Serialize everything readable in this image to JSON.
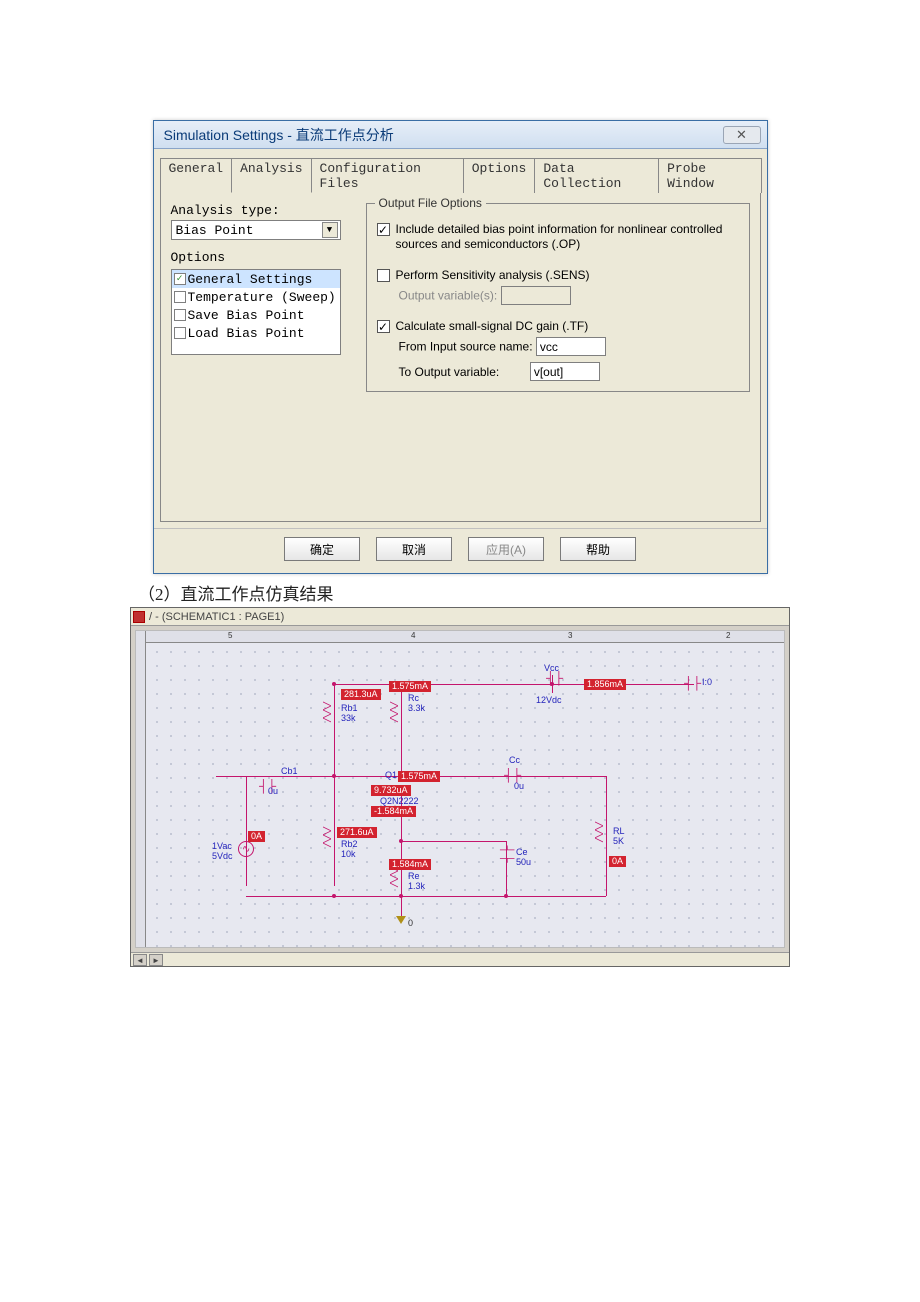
{
  "dialog": {
    "title": "Simulation Settings - 直流工作点分析",
    "tabs": [
      "General",
      "Analysis",
      "Configuration Files",
      "Options",
      "Data Collection",
      "Probe Window"
    ],
    "active_tab_index": 1,
    "analysis_type_label": "Analysis type:",
    "analysis_type_value": "Bias Point",
    "options_label": "Options",
    "option_items": [
      {
        "label": "General Settings",
        "checked": true,
        "selected": true
      },
      {
        "label": "Temperature (Sweep)",
        "checked": false,
        "selected": false
      },
      {
        "label": "Save Bias Point",
        "checked": false,
        "selected": false
      },
      {
        "label": "Load Bias Point",
        "checked": false,
        "selected": false
      }
    ],
    "groupbox_title": "Output File Options",
    "chk_op": {
      "checked": true,
      "label": "Include detailed bias point information for nonlinear controlled sources and semiconductors (.OP)"
    },
    "chk_sens": {
      "checked": false,
      "label": "Perform Sensitivity analysis (.SENS)"
    },
    "sens_var_label": "Output variable(s):",
    "sens_var_value": "",
    "chk_tf": {
      "checked": true,
      "label": "Calculate small-signal DC gain (.TF)"
    },
    "tf_from_label": "From Input source name:",
    "tf_from_value": "vcc",
    "tf_to_label": "To Output variable:",
    "tf_to_value": "v[out]",
    "buttons": {
      "ok": "确定",
      "cancel": "取消",
      "apply": "应用(A)",
      "help": "帮助"
    }
  },
  "document": {
    "line": "（2）直流工作点仿真结果"
  },
  "schematic": {
    "tab_bar": "/ - (SCHEMATIC1 : PAGE1)",
    "ruler_numbers": [
      "5",
      "4",
      "3",
      "2"
    ],
    "labels": {
      "vcc": "Vcc",
      "vcc_dc": "12Vdc",
      "i_probe": "I:0",
      "rb1": "Rb1",
      "rb1_val": "33k",
      "rc": "Rc",
      "rc_val": "3.3k",
      "cb1": "Cb1",
      "cb1_val": "0u",
      "q1": "Q1",
      "q1_model": "Q2N2222",
      "cc": "Cc",
      "cc_val": "0u",
      "rb2": "Rb2",
      "rb2_val": "10k",
      "ce": "Ce",
      "ce_val": "50u",
      "re": "Re",
      "re_val": "1.3k",
      "rl": "RL",
      "rl_val": "5K",
      "source1": "1Vac",
      "source2": "5Vdc",
      "gnd": "0"
    },
    "annotations": {
      "rb1_i": "281.3uA",
      "rc_i": "1.575mA",
      "vcc_i": "1.856mA",
      "q1_ic": "1.575mA",
      "q1_ib": "9.732uA",
      "q1_ie": "-1.584mA",
      "rb2_i": "271.6uA",
      "re_i": "1.584mA",
      "src_i": "0A",
      "rl_i": "0A"
    }
  }
}
